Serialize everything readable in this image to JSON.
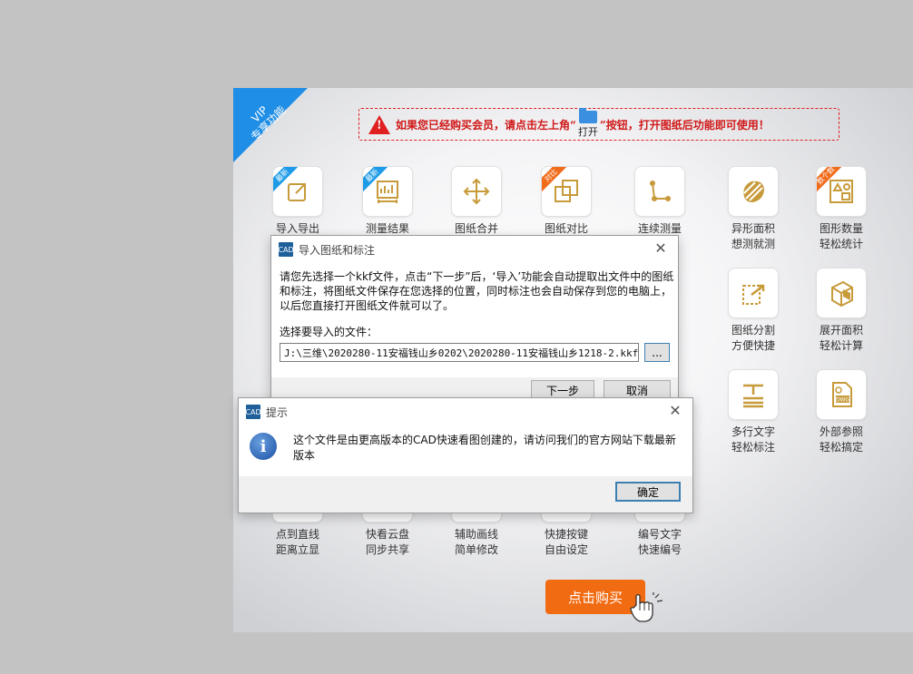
{
  "vip_badge": "VIP\n专享功能",
  "notice": {
    "before": "如果您已经购买会员，请点击左上角“",
    "open_label": "打开",
    "after": "”按钮，打开图纸后功能即可使用！"
  },
  "features": [
    {
      "id": "import-export",
      "label": "导入导出",
      "badge": "最新",
      "badge_color": "blue",
      "icon": "import-export-icon"
    },
    {
      "id": "measure-results",
      "label": "测量结果",
      "badge": "最新",
      "badge_color": "blue",
      "icon": "measure-results-icon"
    },
    {
      "id": "drawing-merge",
      "label": "图纸合并",
      "badge": "",
      "icon": "merge-icon"
    },
    {
      "id": "drawing-compare",
      "label": "图纸对比",
      "badge": "对比",
      "badge_color": "orange",
      "icon": "compare-icon"
    },
    {
      "id": "continuous-measure",
      "label": "连续测量",
      "badge": "",
      "icon": "continuous-measure-icon"
    },
    {
      "id": "irregular-area",
      "label": "异形面积\n想测就测",
      "badge": "",
      "icon": "irregular-area-icon"
    },
    {
      "id": "shape-count",
      "label": "图形数量\n轻松统计",
      "badge": "数个数",
      "badge_color": "orange",
      "icon": "shape-count-icon"
    },
    {
      "id": "drawing-split",
      "label": "图纸分割\n方便快捷",
      "badge": "",
      "icon": "split-icon"
    },
    {
      "id": "unfold-area",
      "label": "展开面积\n轻松计算",
      "badge": "",
      "icon": "unfold-area-icon"
    },
    {
      "id": "multiline-text",
      "label": "多行文字\n轻松标注",
      "badge": "",
      "icon": "multiline-text-icon"
    },
    {
      "id": "external-ref",
      "label": "外部参照\n轻松搞定",
      "badge": "",
      "icon": "dwg-ref-icon"
    },
    {
      "id": "point-to-line",
      "label": "点到直线\n距离立显",
      "badge": "",
      "icon": "point-line-icon"
    },
    {
      "id": "cloud-disk",
      "label": "快看云盘\n同步共享",
      "badge": "",
      "icon": "cloud-icon"
    },
    {
      "id": "aux-line",
      "label": "辅助画线\n简单修改",
      "badge": "",
      "icon": "aux-line-icon"
    },
    {
      "id": "shortcut-keys",
      "label": "快捷按键\n自由设定",
      "badge": "",
      "icon": "keyboard-icon"
    },
    {
      "id": "number-text",
      "label": "编号文字\n快速编号",
      "badge": "",
      "icon": "numbering-icon"
    }
  ],
  "buy_button": "点击购买",
  "import_dialog": {
    "title": "导入图纸和标注",
    "description": "请您先选择一个kkf文件，点击“下一步”后，‘导入’功能会自动提取出文件中的图纸和标注，将图纸文件保存在您选择的位置，同时标注也会自动保存到您的电脑上，以后您直接打开图纸文件就可以了。",
    "file_label": "选择要导入的文件：",
    "file_path": "J:\\三维\\2020280-11安福钱山乡0202\\2020280-11安福钱山乡1218-2.kkf",
    "browse_label": "...",
    "next_label": "下一步",
    "cancel_label": "取消"
  },
  "alert_dialog": {
    "title": "提示",
    "message": "这个文件是由更高版本的CAD快速看图创建的，请访问我们的官方网站下载最新版本",
    "ok_label": "确定"
  },
  "colors": {
    "accent_blue": "#1f8ee6",
    "buy_orange": "#f16b13",
    "notice_red": "#e02020",
    "icon_gold": "#c79a3a"
  }
}
